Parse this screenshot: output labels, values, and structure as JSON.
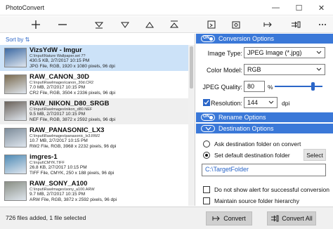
{
  "window": {
    "title": "PhotoConvert",
    "min_glyph": "—",
    "max_glyph": "☐",
    "close_glyph": "✕"
  },
  "toolbar": {
    "buttons": [
      {
        "name": "add-icon"
      },
      {
        "name": "remove-icon"
      },
      {
        "name": "move-to-bottom-icon"
      },
      {
        "name": "move-down-icon"
      },
      {
        "name": "move-up-icon"
      },
      {
        "name": "move-to-top-icon"
      },
      {
        "name": "preview-icon"
      },
      {
        "name": "settings-icon"
      },
      {
        "name": "convert-icon"
      },
      {
        "name": "convert-all-icon"
      },
      {
        "name": "more-icon"
      }
    ]
  },
  "list": {
    "sort_label": "Sort by",
    "items": [
      {
        "name": "VizsYdW - Imgur",
        "path": "C:\\Input\\Nature Wallpaper.set 7?",
        "meta1": "430.5 KB, 2/7/2017 10:15 PM",
        "meta2": "JPG File, RGB, 1920 x 1080 pixels, 96 dpi",
        "thumb_color": "#3d6aa3"
      },
      {
        "name": "RAW_CANON_30D",
        "path": "C:\\Input\\RawImages\\canon_30d.CR2",
        "meta1": "7.0 MB, 2/7/2017 10:15 PM",
        "meta2": "CR2 File, RGB, 3504 x 2336 pixels, 96 dpi",
        "thumb_color": "#7a6a4e"
      },
      {
        "name": "RAW_NIKON_D80_SRGB",
        "path": "C:\\Input\\RawImages\\nikon_d80.NEF",
        "meta1": "9.5 MB, 2/7/2017 10:15 PM",
        "meta2": "NEF File, RGB, 3872 x 2592 pixels, 96 dpi",
        "thumb_color": "#6b625a"
      },
      {
        "name": "RAW_PANASONIC_LX3",
        "path": "C:\\Input\\RawImages\\panasonic_lx3.RW2",
        "meta1": "10.7 MB, 2/7/2017 10:15 PM",
        "meta2": "RW2 File, RGB, 3968 x 2232 pixels, 96 dpi",
        "thumb_color": "#7d8c9a"
      },
      {
        "name": "imgres-1",
        "path": "C:\\Input\\CMYK.TIFF",
        "meta1": "26.8 KB, 2/7/2017 10:15 PM",
        "meta2": "TIFF File, CMYK, 250 x 188 pixels, 96 dpi",
        "thumb_color": "#4f8bb5"
      },
      {
        "name": "RAW_SONY_A100",
        "path": "C:\\Input\\RawImages\\sony_a100.ARW",
        "meta1": "9.7 MB, 2/7/2017 10:15 PM",
        "meta2": "ARW File, RGB, 3872 x 2592 pixels, 96 dpi",
        "thumb_color": "#8a8f85"
      }
    ]
  },
  "conversion": {
    "header": "Conversion Options",
    "toggle_text": "ON",
    "image_type_label": "Image Type:",
    "image_type_value": "JPEG Image (*.jpg)",
    "color_model_label": "Color Model:",
    "color_model_value": "RGB",
    "jpeg_quality_label": "JPEG Quality:",
    "jpeg_quality_value": "80",
    "jpeg_quality_unit": "%",
    "jpeg_quality_fraction": 0.8,
    "resolution_label": "Resolution:",
    "resolution_value": "144",
    "resolution_unit": "dpi",
    "resolution_checked": true
  },
  "rename": {
    "header": "Rename Options",
    "toggle_text": "ON"
  },
  "destination": {
    "header": "Destination Options",
    "ask_label": "Ask destination folder on convert",
    "default_label": "Set default destination folder",
    "select_label": "Select",
    "folder_value": "C:\\TargetFolder",
    "no_alert_label": "Do not show alert for successful conversion",
    "maintain_label": "Maintain source folder hierarchy"
  },
  "status": {
    "text": "726 files added, 1 file selected",
    "convert_label": "Convert",
    "convert_all_label": "Convert All"
  },
  "colors": {
    "accent": "#3a78d8",
    "selected_row": "#cce2f8"
  }
}
